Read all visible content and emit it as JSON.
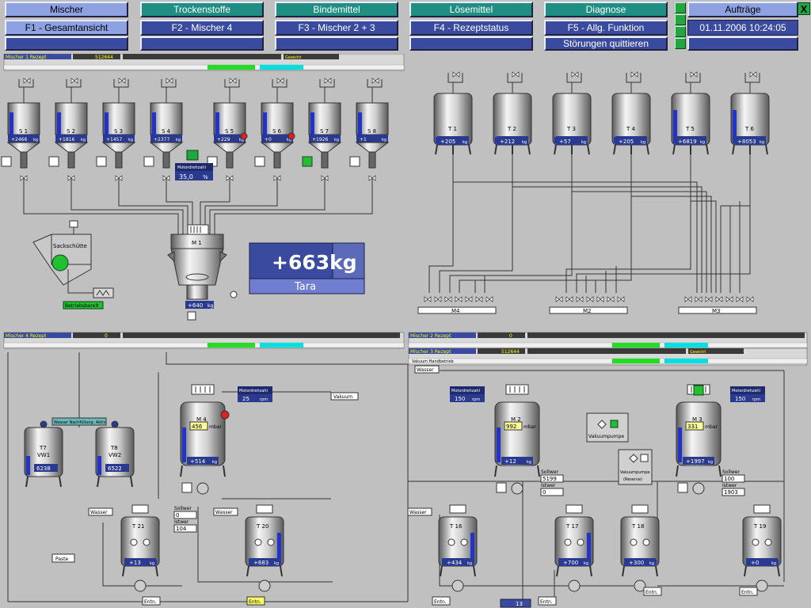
{
  "nav": {
    "row1": [
      "Mischer",
      "Trockenstoffe",
      "Bindemittel",
      "Lösemittel",
      "Diagnose"
    ],
    "row2": [
      "F1 - Gesamtansicht",
      "F2 - Mischer 4",
      "F3 - Mischer 2 + 3",
      "F4 - Rezeptstatus",
      "F5 - Allg. Funktion"
    ],
    "row3_right": "Störungen quittieren",
    "auftraege": "Aufträge",
    "close": "X",
    "datetime": "01.11.2006 10:24:05"
  },
  "colors": {
    "nav_lavender": "#8ea2e2",
    "nav_teal": "#1f8f84",
    "nav_navy": "#3a4a9e",
    "background": "#c0c0c0",
    "green_status": "#21a642",
    "cyan_status": "#00e0e0"
  },
  "status_bars": {
    "m1": {
      "title": "Mischer 1 Rezept",
      "code": "512644",
      "tag": "Gewicht"
    },
    "m4": {
      "title": "Mischer 4 Rezept",
      "code": "0"
    },
    "m2": {
      "title": "Mischer 2 Rezept",
      "code": "0"
    },
    "m3": {
      "title": "Mischer 3 Rezept",
      "code": "512644",
      "tag": "Gewicht",
      "sub": "Vakuum Handbetrieb"
    }
  },
  "silos": [
    {
      "label": "S 1",
      "value": "+2466"
    },
    {
      "label": "S 2",
      "value": "+1816"
    },
    {
      "label": "S 3",
      "value": "+1457"
    },
    {
      "label": "S 4",
      "value": "+2377"
    },
    {
      "label": "S 5",
      "value": "+229"
    },
    {
      "label": "S 6",
      "value": "+0"
    },
    {
      "label": "S 7",
      "value": "+1926"
    },
    {
      "label": "S 8",
      "value": "+1"
    }
  ],
  "tanks_top": [
    {
      "label": "T 1",
      "value": "+205"
    },
    {
      "label": "T 2",
      "value": "+212"
    },
    {
      "label": "T 3",
      "value": "+57"
    },
    {
      "label": "T 4",
      "value": "+205"
    },
    {
      "label": "T 5",
      "value": "+6819"
    },
    {
      "label": "T 6",
      "value": "+8053"
    }
  ],
  "unit_kg": "kg",
  "unit_mbar": "mbar",
  "unit_rpm": "rpm",
  "unit_pct": "%",
  "motor_label": "Motordrehzahl",
  "motor_1": {
    "value": "35,0"
  },
  "mixer_m1": {
    "label": "M 1",
    "value": "+640"
  },
  "scale": {
    "value": "+663kg",
    "tara": "Tara"
  },
  "sackschuette": "Sackschütte",
  "betrieb": "Betriebsbereit",
  "manifolds": [
    "M4",
    "M2",
    "M3"
  ],
  "mixer_m4": {
    "label": "M 4",
    "pressure": "456",
    "weight": "+514",
    "rpm": "25"
  },
  "mixer_m2": {
    "label": "M 2",
    "pressure": "992",
    "weight": "+12",
    "rpm": "150"
  },
  "mixer_m3": {
    "label": "M 3",
    "pressure": "331",
    "weight": "+1997",
    "rpm": "150"
  },
  "tanks_tv": [
    {
      "label": "T7",
      "sub": "VW1",
      "value": "6238"
    },
    {
      "label": "T8",
      "sub": "VW2",
      "value": "6522"
    }
  ],
  "wasser_nachfuellung": "Wasser Nachfüllung: Aktiv",
  "sollwert": "Sollwer",
  "istwert": "Istwer",
  "sollist": [
    {
      "soll": "0",
      "ist": "104"
    },
    {
      "soll": "5199",
      "ist": "0"
    },
    {
      "soll": "100",
      "ist": "1903"
    }
  ],
  "tanks_bottom": [
    {
      "label": "T 21",
      "value": "+13"
    },
    {
      "label": "T 20",
      "value": "+683"
    },
    {
      "label": "T 16",
      "value": "+434"
    },
    {
      "label": "T 17",
      "value": "+700"
    },
    {
      "label": "T 18",
      "value": "+300"
    },
    {
      "label": "T 19",
      "value": "+0"
    }
  ],
  "vakuumpumpe": "Vakuumpumpe",
  "vakuumpumpe_reserve": "(Reserve)",
  "vakuum": "Vakuum",
  "wasser": "Wasser",
  "paste": "Paste",
  "entn": "Entn.",
  "bottom_value": "13"
}
